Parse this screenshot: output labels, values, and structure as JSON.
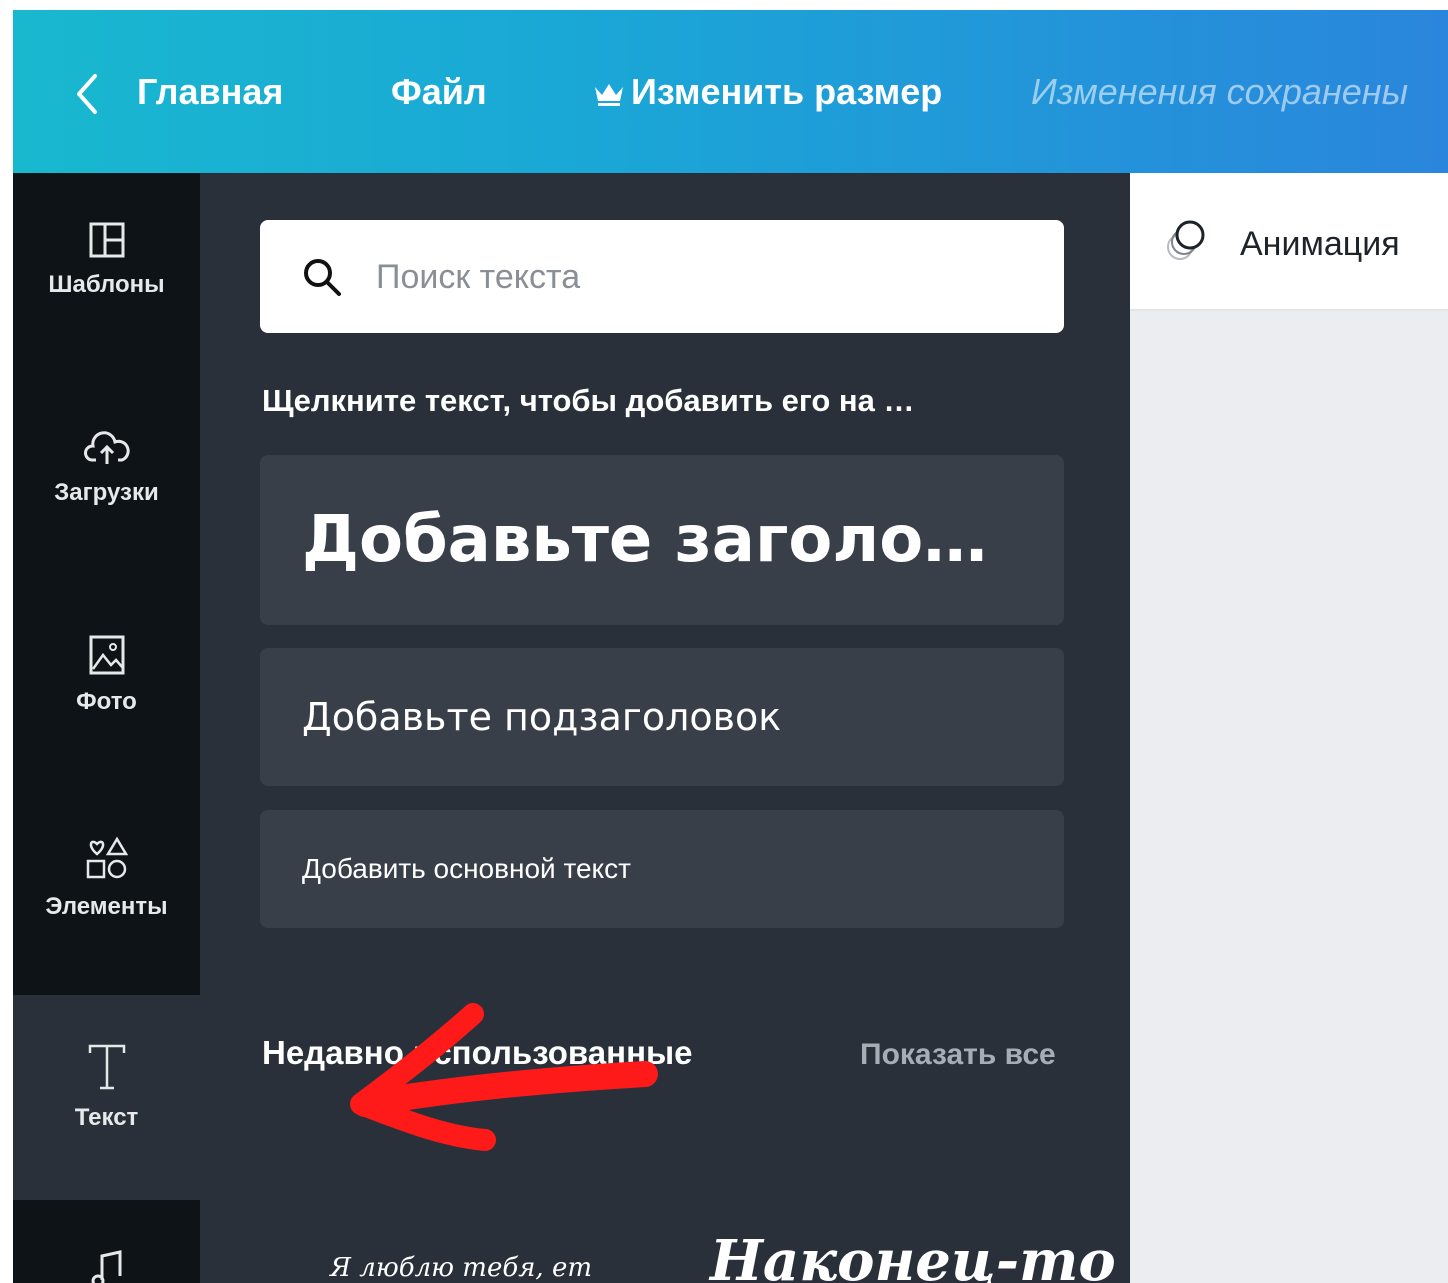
{
  "topbar": {
    "back_icon": "chevron-left-icon",
    "home_label": "Главная",
    "file_label": "Файл",
    "resize_icon": "crown-icon",
    "resize_label": "Изменить размер",
    "saved_status": "Изменения сохранены",
    "gradient_start": "#19b8cf",
    "gradient_end": "#2a86dc"
  },
  "sidebar": {
    "items": [
      {
        "label": "Шаблоны",
        "icon": "templates-icon"
      },
      {
        "label": "Загрузки",
        "icon": "cloud-upload-icon"
      },
      {
        "label": "Фото",
        "icon": "photo-icon"
      },
      {
        "label": "Элементы",
        "icon": "shapes-icon"
      },
      {
        "label": "Текст",
        "icon": "text-icon",
        "active": true
      },
      {
        "label": "",
        "icon": "music-icon"
      }
    ]
  },
  "text_panel": {
    "search_placeholder": "Поиск текста",
    "hint": "Щелкните текст, чтобы добавить его на …",
    "heading_card": "Добавьте заголо…",
    "subheading_card": "Добавьте подзаголовок",
    "body_card": "Добавить основной текст",
    "recent_title": "Недавно использованные",
    "show_all": "Показать все",
    "recent_samples": [
      "Я люблю тебя, ет",
      "Наконец-то"
    ],
    "collapse_icon": "chevron-left-icon"
  },
  "editor_toolbar": {
    "animation_icon": "animation-icon",
    "animation_label": "Анимация"
  },
  "colors": {
    "rail_bg": "#0e1318",
    "panel_bg": "#293039",
    "card_bg": "#393f48",
    "canvas_bg": "#ebedf0",
    "annotation_arrow": "#ff1a1a"
  }
}
